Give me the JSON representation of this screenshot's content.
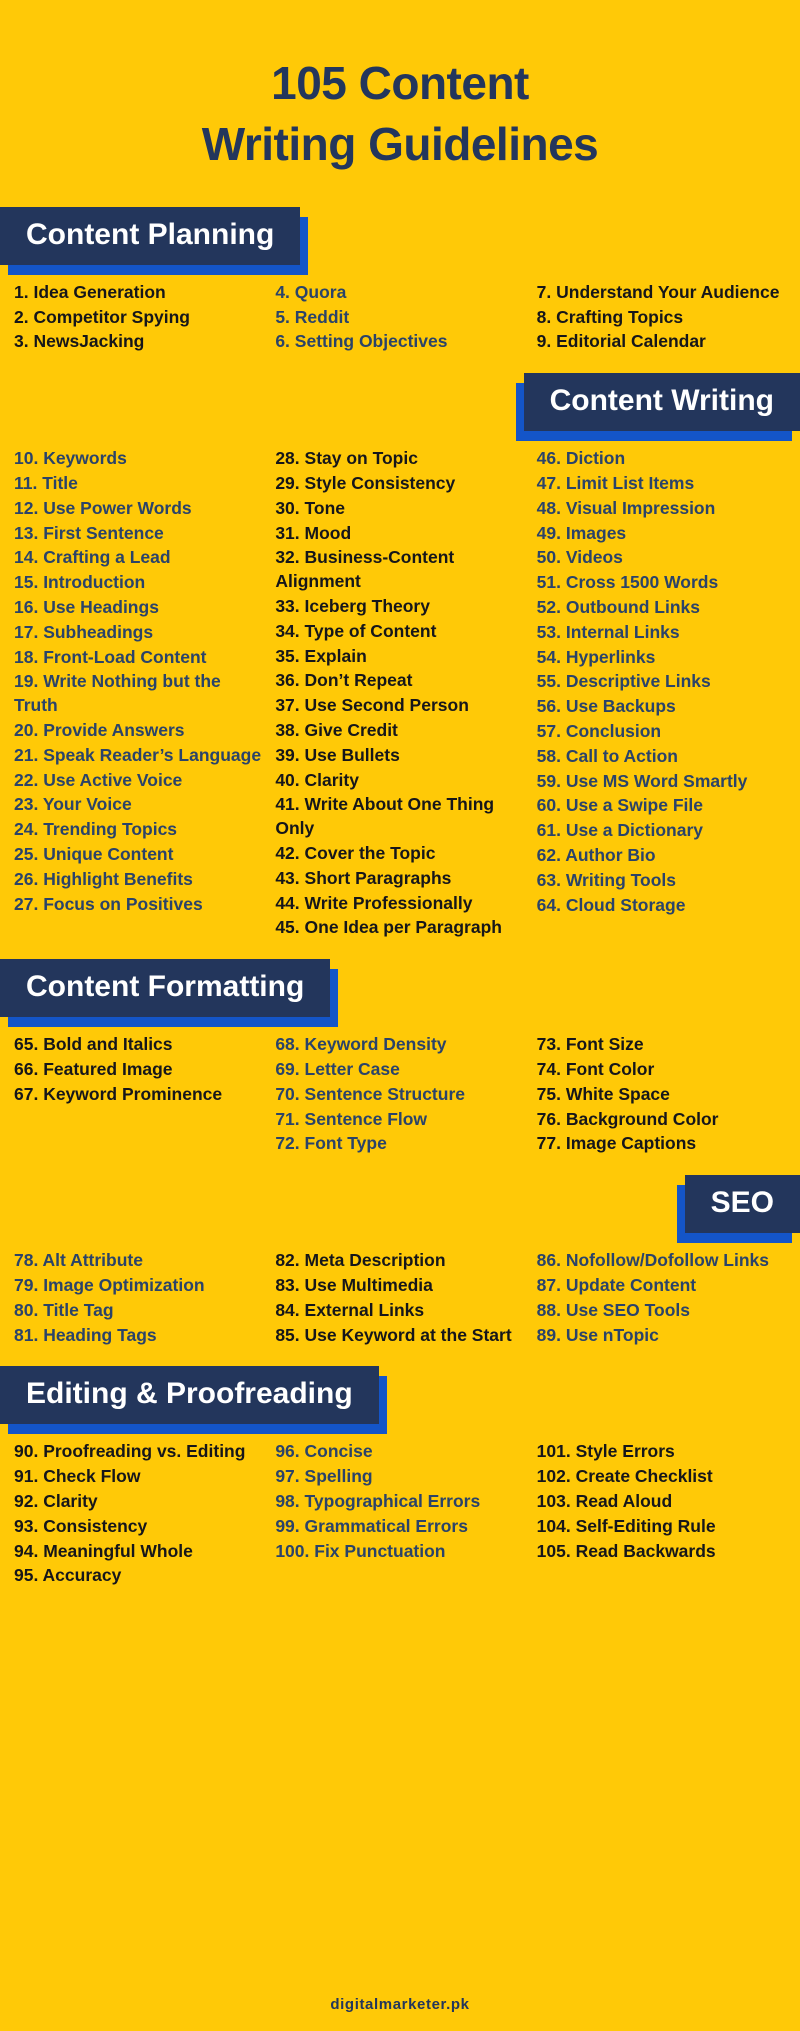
{
  "title": {
    "line1": "105 Content",
    "line2": "Writing Guidelines"
  },
  "colors": {
    "background": "#FFC907",
    "banner": "#23365C",
    "banner_shadow": "#1455C8",
    "text_navy": "#2B4369",
    "text_black": "#16161A",
    "banner_text": "#FFFFFF"
  },
  "footer": "digitalmarketer.pk",
  "sections": [
    {
      "heading": "Content Planning",
      "align": "left",
      "columns": [
        {
          "color": "black",
          "items": [
            "1. Idea Generation",
            "2. Competitor Spying",
            "3. NewsJacking"
          ]
        },
        {
          "color": "navy",
          "items": [
            "4. Quora",
            "5. Reddit",
            "6. Setting Objectives"
          ]
        },
        {
          "color": "black",
          "items": [
            "7. Understand Your Audience",
            "8. Crafting Topics",
            "9. Editorial Calendar"
          ]
        }
      ]
    },
    {
      "heading": "Content Writing",
      "align": "right",
      "columns": [
        {
          "color": "navy",
          "items": [
            "10. Keywords",
            "11. Title",
            "12. Use Power Words",
            "13. First Sentence",
            "14. Crafting a Lead",
            "15. Introduction",
            "16. Use Headings",
            "17. Subheadings",
            "18. Front-Load Content",
            "19. Write Nothing but the Truth",
            "20. Provide Answers",
            "21. Speak Reader’s Language",
            "22. Use Active Voice",
            "23. Your Voice",
            "24. Trending Topics",
            "25. Unique Content",
            "26. Highlight Benefits",
            "27. Focus on Positives"
          ]
        },
        {
          "color": "black",
          "items": [
            "28. Stay on Topic",
            "29. Style Consistency",
            "30. Tone",
            "31. Mood",
            "32. Business-Content Alignment",
            "33. Iceberg Theory",
            "34. Type of Content",
            "35. Explain",
            "36. Don’t Repeat",
            "37. Use Second Person",
            "38. Give Credit",
            "39. Use Bullets",
            "40. Clarity",
            "41. Write About One Thing Only",
            "42. Cover the Topic",
            "43. Short Paragraphs",
            "44. Write Professionally",
            "45. One Idea per Paragraph"
          ]
        },
        {
          "color": "navy",
          "items": [
            "46. Diction",
            "47. Limit List Items",
            "48. Visual Impression",
            "49. Images",
            "50. Videos",
            "51. Cross 1500 Words",
            "52. Outbound Links",
            "53. Internal Links",
            "54. Hyperlinks",
            "55. Descriptive Links",
            "56. Use Backups",
            "57. Conclusion",
            "58. Call to Action",
            "59. Use MS Word Smartly",
            "60. Use a Swipe File",
            "61. Use a Dictionary",
            "62. Author Bio",
            "63. Writing Tools",
            "64. Cloud Storage"
          ]
        }
      ]
    },
    {
      "heading": "Content Formatting",
      "align": "left",
      "columns": [
        {
          "color": "black",
          "items": [
            "65. Bold and Italics",
            "66. Featured Image",
            "67. Keyword Prominence"
          ]
        },
        {
          "color": "navy",
          "items": [
            "68. Keyword Density",
            "69. Letter Case",
            "70. Sentence Structure",
            "71. Sentence Flow",
            "72. Font Type"
          ]
        },
        {
          "color": "black",
          "items": [
            "73. Font Size",
            "74. Font Color",
            "75. White Space",
            "76. Background Color",
            "77. Image Captions"
          ]
        }
      ]
    },
    {
      "heading": "SEO",
      "align": "right",
      "columns": [
        {
          "color": "navy",
          "items": [
            "78. Alt Attribute",
            "79. Image Optimization",
            "80. Title Tag",
            "81. Heading Tags"
          ]
        },
        {
          "color": "black",
          "items": [
            "82. Meta Description",
            "83. Use Multimedia",
            "84. External Links",
            "85. Use Keyword at the Start"
          ]
        },
        {
          "color": "navy",
          "items": [
            "86. Nofollow/Dofollow Links",
            "87. Update Content",
            "88. Use SEO Tools",
            "89. Use nTopic"
          ]
        }
      ]
    },
    {
      "heading": "Editing & Proofreading",
      "align": "left",
      "columns": [
        {
          "color": "black",
          "items": [
            "90. Proofreading vs. Editing",
            "91. Check Flow",
            "92. Clarity",
            "93. Consistency",
            "94. Meaningful Whole",
            "95. Accuracy"
          ]
        },
        {
          "color": "navy",
          "items": [
            "96. Concise",
            "97. Spelling",
            "98. Typographical Errors",
            "99. Grammatical Errors",
            "100. Fix Punctuation"
          ]
        },
        {
          "color": "black",
          "items": [
            "101. Style Errors",
            "102. Create Checklist",
            "103. Read Aloud",
            "104. Self-Editing Rule",
            "105. Read Backwards"
          ]
        }
      ]
    }
  ]
}
